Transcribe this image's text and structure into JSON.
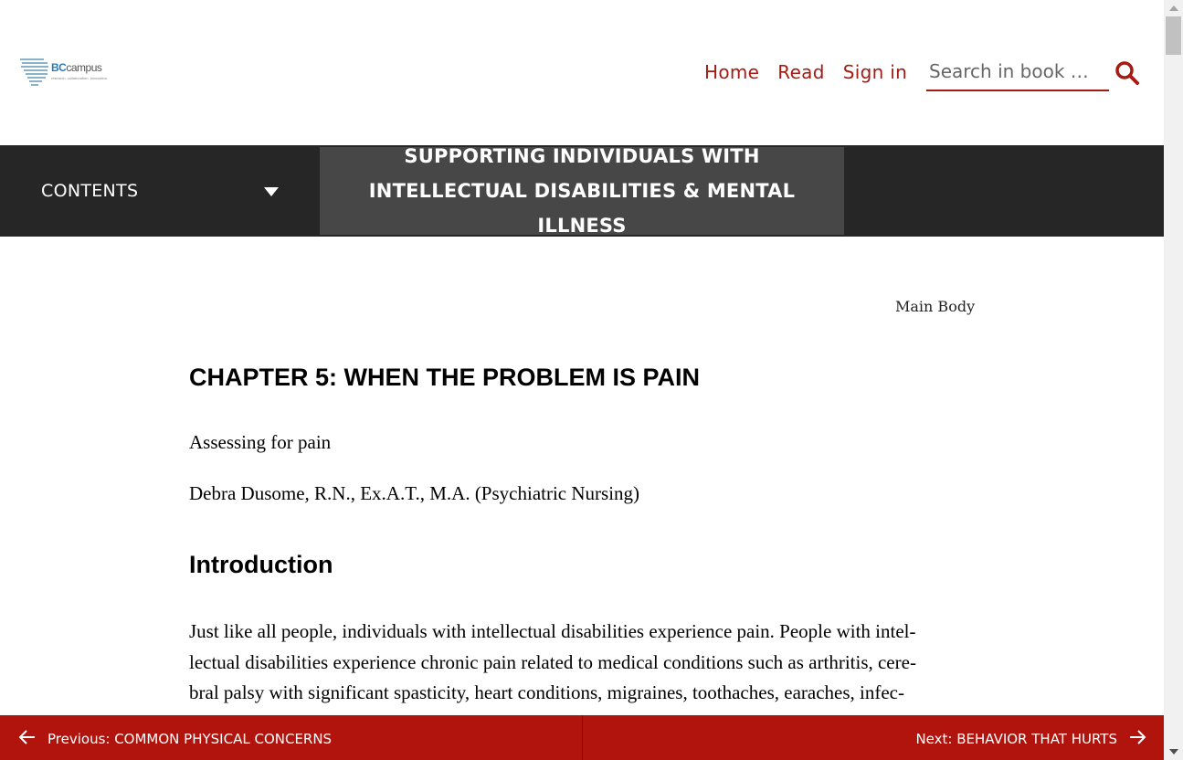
{
  "header": {
    "logo_text_bold": "BC",
    "logo_text": "campus",
    "logo_tagline": "research. collaboration. innovation.",
    "nav": [
      "Home",
      "Read",
      "Sign in"
    ],
    "search_placeholder": "Search in book …",
    "accent_color": "#a31b13"
  },
  "bookbar": {
    "contents_label": "CONTENTS",
    "book_title": "SUPPORTING INDIVIDUALS WITH INTELLECTUAL DISABILITIES & MENTAL ILLNESS"
  },
  "content": {
    "part_label": "Main Body",
    "chapter_title": "CHAPTER 5: WHEN THE PROBLEM IS PAIN",
    "subtitle": "Assessing for pain",
    "author": "Debra Dusome, R.N., Ex.A.T., M.A. (Psychiatric Nursing)",
    "section_heading": "Introduction",
    "paragraph_lines": [
      "Just like all people, individuals with intellectual disabilities experience pain. People with intel-",
      "lectual disabilities experience chronic pain related to medical conditions such as arthritis, cere-",
      "bral palsy with significant spasticity, heart conditions, migraines, toothaches, earaches, infec-"
    ]
  },
  "footer": {
    "prev_label": "Previous: COMMON PHYSICAL CONCERNS",
    "next_label": "Next: BEHAVIOR THAT HURTS",
    "bar_color": "#b0140c"
  }
}
